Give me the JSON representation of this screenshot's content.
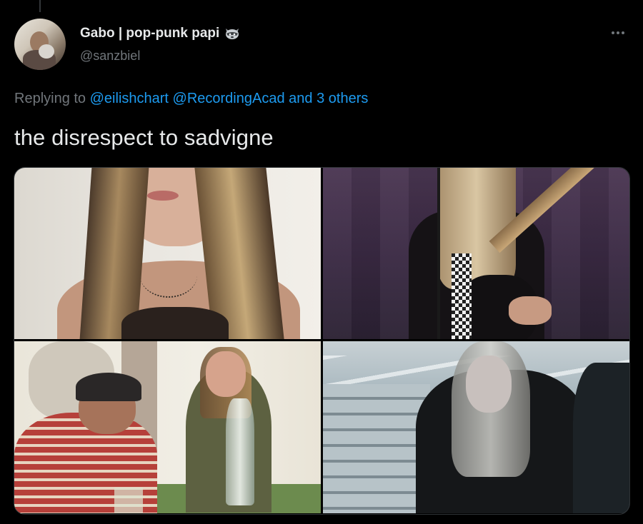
{
  "author": {
    "display_name": "Gabo | pop-punk papi",
    "name_emoji": "raccoon-icon",
    "handle": "@sanzbiel"
  },
  "reply": {
    "prefix": "Replying to",
    "mentions": [
      "@eilishchart",
      "@RecordingAcad"
    ],
    "others": "and 3 others"
  },
  "tweet": {
    "text": "the disrespect to sadvigne"
  },
  "media": {
    "count": 4
  },
  "colors": {
    "background": "#000000",
    "text": "#e7e9ea",
    "secondary": "#71767b",
    "link": "#1d9bf0"
  }
}
